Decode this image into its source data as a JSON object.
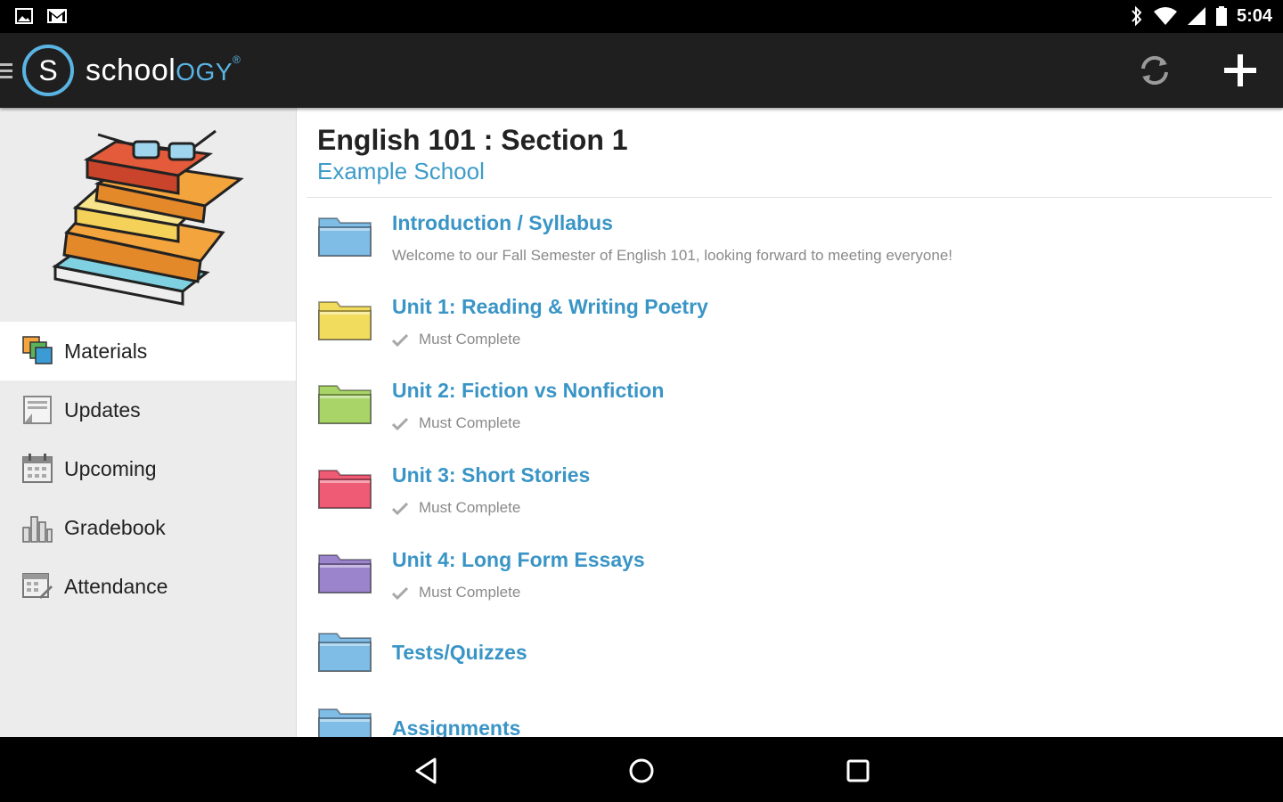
{
  "status_bar": {
    "time": "5:04",
    "left_icons": [
      "image-icon",
      "gmail-icon"
    ],
    "right_icons": [
      "bluetooth-icon",
      "wifi-icon",
      "signal-icon",
      "battery-icon"
    ]
  },
  "app_bar": {
    "logo_text_plain": "school",
    "logo_text_highlight": "OGY",
    "logo_trademark": "®",
    "actions": [
      "sync-icon",
      "add-icon"
    ]
  },
  "sidebar": {
    "items": [
      {
        "label": "Materials",
        "icon": "materials-icon",
        "active": true
      },
      {
        "label": "Updates",
        "icon": "updates-icon",
        "active": false
      },
      {
        "label": "Upcoming",
        "icon": "calendar-icon",
        "active": false
      },
      {
        "label": "Gradebook",
        "icon": "gradebook-icon",
        "active": false
      },
      {
        "label": "Attendance",
        "icon": "attendance-icon",
        "active": false
      }
    ]
  },
  "course": {
    "title": "English 101 : Section 1",
    "school": "Example School"
  },
  "materials": [
    {
      "title": "Introduction / Syllabus",
      "subtitle": "Welcome to our Fall Semester of English 101, looking forward to meeting everyone!",
      "color": "#7fbce6",
      "must_complete": false
    },
    {
      "title": "Unit 1: Reading & Writing Poetry",
      "subtitle": "Must Complete",
      "color": "#f2dc5d",
      "must_complete": true
    },
    {
      "title": "Unit 2: Fiction vs Nonfiction",
      "subtitle": "Must Complete",
      "color": "#a9d468",
      "must_complete": true
    },
    {
      "title": "Unit 3: Short Stories",
      "subtitle": "Must Complete",
      "color": "#ef5a75",
      "must_complete": true
    },
    {
      "title": "Unit 4: Long Form Essays",
      "subtitle": "Must Complete",
      "color": "#9c84cc",
      "must_complete": true
    },
    {
      "title": "Tests/Quizzes",
      "subtitle": "",
      "color": "#7fbce6",
      "must_complete": false
    },
    {
      "title": "Assignments",
      "subtitle": "",
      "color": "#7fbce6",
      "must_complete": false
    }
  ],
  "colors": {
    "accent": "#3a95c6",
    "app_bar": "#1f1f1f",
    "sidebar": "#ececec"
  },
  "nav_bar": [
    "back-icon",
    "home-icon",
    "recents-icon"
  ]
}
